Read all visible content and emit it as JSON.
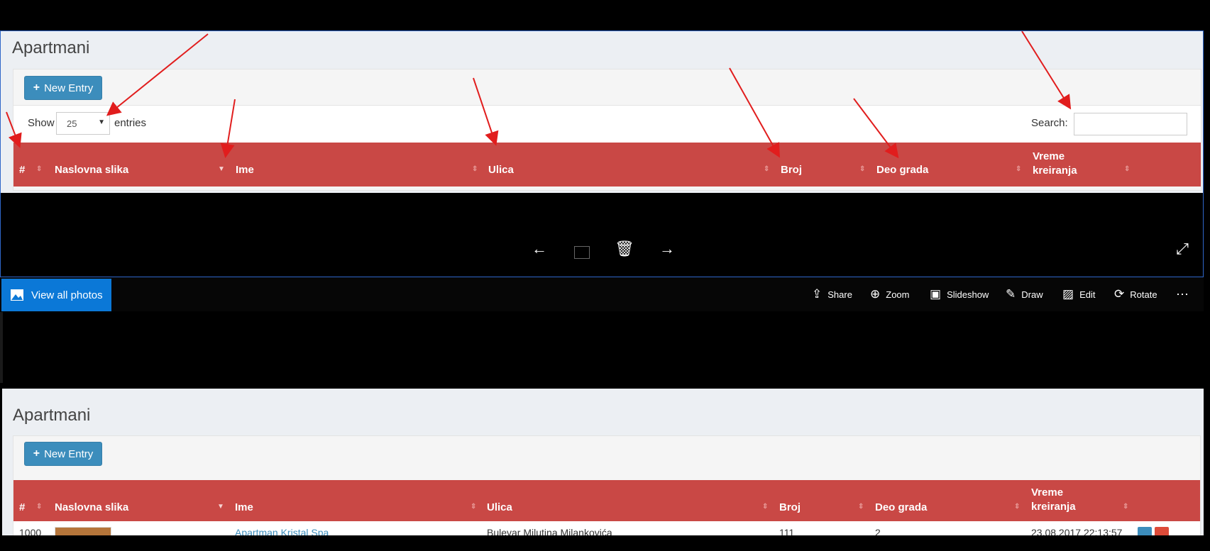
{
  "top": {
    "title": "Apartmani",
    "new_entry_label": "New Entry",
    "show_label": "Show",
    "page_size": "25",
    "entries_label": "entries",
    "search_label": "Search:",
    "search_value": "",
    "columns": [
      "#",
      "Naslovna slika",
      "Ime",
      "Ulica",
      "Broj",
      "Deo grada",
      "Vreme kreiranja"
    ]
  },
  "viewer": {
    "nav": [
      "arrow-left",
      "display",
      "trash",
      "arrow-right",
      "expand"
    ],
    "view_all_label": "View all photos",
    "toolbar": [
      {
        "label": "Share",
        "icon": "share-icon"
      },
      {
        "label": "Zoom",
        "icon": "zoom-icon"
      },
      {
        "label": "Slideshow",
        "icon": "slideshow-icon"
      },
      {
        "label": "Draw",
        "icon": "draw-icon"
      },
      {
        "label": "Edit",
        "icon": "edit-icon"
      },
      {
        "label": "Rotate",
        "icon": "rotate-icon"
      }
    ],
    "more_label": "⋯"
  },
  "bottom": {
    "title": "Apartmani",
    "new_entry_label": "New Entry",
    "columns": [
      "#",
      "Naslovna slika",
      "Ime",
      "Ulica",
      "Broj",
      "Deo grada",
      "Vreme kreiranja"
    ],
    "row": {
      "id": "1000",
      "name": "Apartman Kristal Spa",
      "street": "Bulevar Milutina Milankovića",
      "number": "111",
      "district": "2",
      "created": "23.08.2017 22:13:57"
    }
  },
  "colors": {
    "header_red": "#c94845",
    "button_blue": "#3c8dbc",
    "photos_blue": "#0b78d7",
    "annotation_red": "#e11d1d"
  }
}
